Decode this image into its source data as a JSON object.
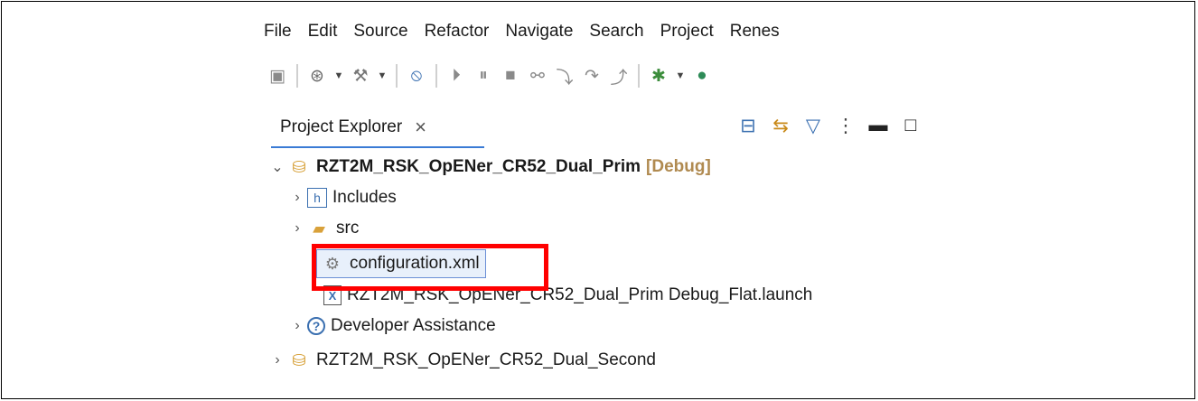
{
  "menu": [
    "File",
    "Edit",
    "Source",
    "Refactor",
    "Navigate",
    "Search",
    "Project",
    "Renes"
  ],
  "view": {
    "tab_label": "Project Explorer",
    "close_glyph": "×"
  },
  "tree": {
    "project1": {
      "name": "RZT2M_RSK_OpENer_CR52_Dual_Prim",
      "config": "[Debug]"
    },
    "includes": "Includes",
    "src": "src",
    "configuration": "configuration.xml",
    "launch": "RZT2M_RSK_OpENer_CR52_Dual_Prim Debug_Flat.launch",
    "assistance": "Developer Assistance",
    "project2": "RZT2M_RSK_OpENer_CR52_Dual_Second"
  },
  "colors": {
    "tab_underline": "#3a7bd5",
    "highlight_box": "#ff0000",
    "selection": "#e8f0fb"
  }
}
